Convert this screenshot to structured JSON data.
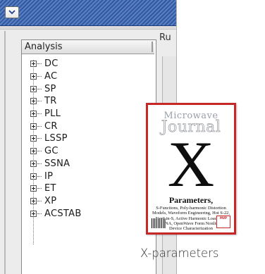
{
  "window": {
    "menu_icon": "chevron-down-icon"
  },
  "tree": {
    "header": "Analysis",
    "items": [
      {
        "label": "DC"
      },
      {
        "label": "AC"
      },
      {
        "label": "SP"
      },
      {
        "label": "TR"
      },
      {
        "label": "PLL"
      },
      {
        "label": "CR"
      },
      {
        "label": "LSSP"
      },
      {
        "label": "GC"
      },
      {
        "label": "SSNA"
      },
      {
        "label": "IP"
      },
      {
        "label": "ET"
      },
      {
        "label": "XP"
      },
      {
        "label": "ACSTAB"
      }
    ]
  },
  "right_pane": {
    "label": "Ru"
  },
  "cover": {
    "logo_top": "Microwave",
    "logo_main": "Journal",
    "letter": "X",
    "headline": "Parameters,",
    "body": "S-Functions, Poly-harmonic Distortion Models, Waveform Engineering, Hot S-22, NonLin-S, Active Harmonic Load Pull, NVNA, OpenWave Form Nonlinear Device Characterization",
    "badge": "MVP",
    "border_color": "#c62828"
  },
  "caption": "X-parameters"
}
